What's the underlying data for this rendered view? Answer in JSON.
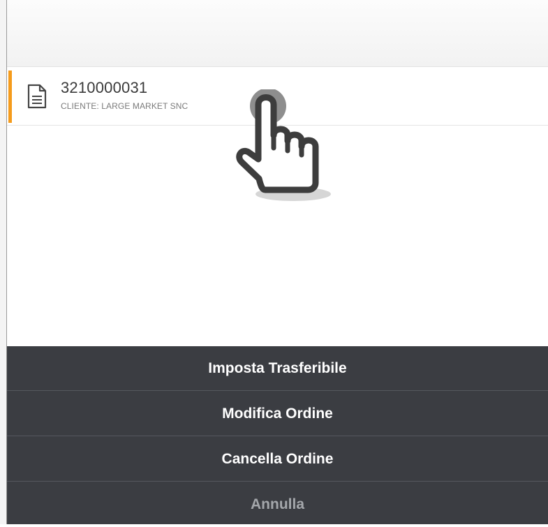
{
  "order": {
    "number": "3210000031",
    "customer": "CLIENTE: LARGE MARKET SNC"
  },
  "icons": {
    "document": "document-icon",
    "pointer": "hand-pointer-icon"
  },
  "colors": {
    "accent": "#f59b1b",
    "sheet_background": "#3b3d42",
    "sheet_text": "#ffffff",
    "cancel_text": "#a4a7ab"
  },
  "action_sheet": {
    "items": [
      {
        "label": "Imposta Trasferibile"
      },
      {
        "label": "Modifica Ordine"
      },
      {
        "label": "Cancella Ordine"
      },
      {
        "label": "Annulla"
      }
    ]
  }
}
